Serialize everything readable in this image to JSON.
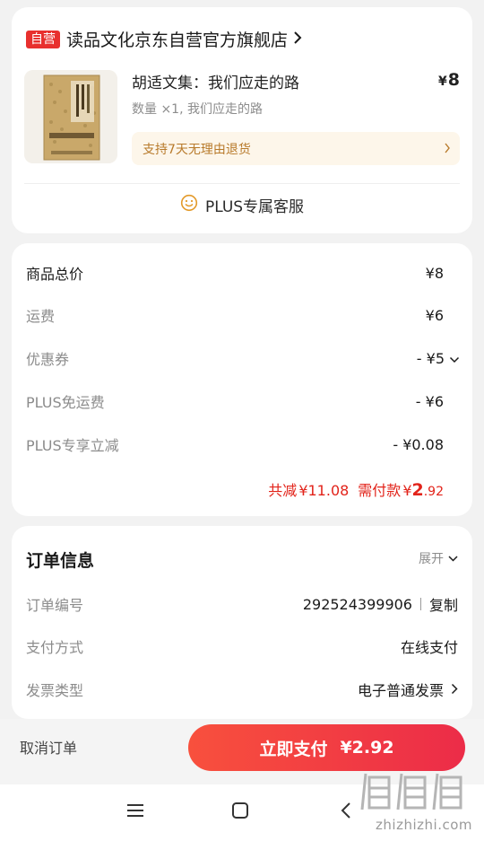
{
  "store": {
    "badge": "自营",
    "name": "读品文化京东自营官方旗舰店"
  },
  "product": {
    "title": "胡适文集：我们应走的路",
    "price_symbol": "¥",
    "price": "8",
    "spec": "数量 ×1, 我们应走的路",
    "return_policy": "支持7天无理由退货",
    "cover_image": "book-cover"
  },
  "service": {
    "label": "PLUS专属客服",
    "icon": "smile-face-icon"
  },
  "price_details": {
    "rows": [
      {
        "label": "商品总价",
        "value": "¥8"
      },
      {
        "label": "运费",
        "value": "¥6"
      },
      {
        "label": "优惠券",
        "value": "- ¥5"
      },
      {
        "label": "PLUS免运费",
        "value": "- ¥6"
      },
      {
        "label": "PLUS专享立减",
        "value": "- ¥0.08"
      }
    ],
    "total_discount_label": "共减",
    "total_discount": "¥11.08",
    "payable_label": "需付款",
    "payable_symbol": "¥",
    "payable_int": "2",
    "payable_dec": ".92"
  },
  "order_info": {
    "title": "订单信息",
    "expand_label": "展开",
    "rows": [
      {
        "label": "订单编号",
        "value": "292524399906",
        "action": "复制"
      },
      {
        "label": "支付方式",
        "value": "在线支付"
      },
      {
        "label": "发票类型",
        "value": "电子普通发票"
      }
    ]
  },
  "bottom": {
    "cancel_label": "取消订单",
    "pay_label": "立即支付",
    "pay_amount": "¥2.92"
  },
  "watermark": {
    "glyphs": "值",
    "domain": "zhizhizhi.com"
  },
  "colors": {
    "accent_red": "#e2231a",
    "badge_red": "#e8302e",
    "return_text": "#b87a2b",
    "return_bg": "#fdf6ea",
    "pay_gradient_start": "#f8503d",
    "pay_gradient_end": "#ec2c48",
    "service_icon": "#e39a2a"
  }
}
